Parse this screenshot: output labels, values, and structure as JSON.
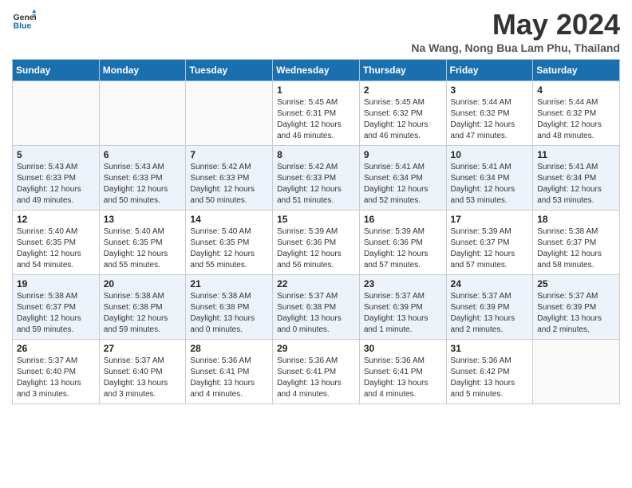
{
  "header": {
    "logo_general": "General",
    "logo_blue": "Blue",
    "month_year": "May 2024",
    "location": "Na Wang, Nong Bua Lam Phu, Thailand"
  },
  "days_of_week": [
    "Sunday",
    "Monday",
    "Tuesday",
    "Wednesday",
    "Thursday",
    "Friday",
    "Saturday"
  ],
  "weeks": [
    [
      {
        "day": "",
        "info": ""
      },
      {
        "day": "",
        "info": ""
      },
      {
        "day": "",
        "info": ""
      },
      {
        "day": "1",
        "info": "Sunrise: 5:45 AM\nSunset: 6:31 PM\nDaylight: 12 hours\nand 46 minutes."
      },
      {
        "day": "2",
        "info": "Sunrise: 5:45 AM\nSunset: 6:32 PM\nDaylight: 12 hours\nand 46 minutes."
      },
      {
        "day": "3",
        "info": "Sunrise: 5:44 AM\nSunset: 6:32 PM\nDaylight: 12 hours\nand 47 minutes."
      },
      {
        "day": "4",
        "info": "Sunrise: 5:44 AM\nSunset: 6:32 PM\nDaylight: 12 hours\nand 48 minutes."
      }
    ],
    [
      {
        "day": "5",
        "info": "Sunrise: 5:43 AM\nSunset: 6:33 PM\nDaylight: 12 hours\nand 49 minutes."
      },
      {
        "day": "6",
        "info": "Sunrise: 5:43 AM\nSunset: 6:33 PM\nDaylight: 12 hours\nand 50 minutes."
      },
      {
        "day": "7",
        "info": "Sunrise: 5:42 AM\nSunset: 6:33 PM\nDaylight: 12 hours\nand 50 minutes."
      },
      {
        "day": "8",
        "info": "Sunrise: 5:42 AM\nSunset: 6:33 PM\nDaylight: 12 hours\nand 51 minutes."
      },
      {
        "day": "9",
        "info": "Sunrise: 5:41 AM\nSunset: 6:34 PM\nDaylight: 12 hours\nand 52 minutes."
      },
      {
        "day": "10",
        "info": "Sunrise: 5:41 AM\nSunset: 6:34 PM\nDaylight: 12 hours\nand 53 minutes."
      },
      {
        "day": "11",
        "info": "Sunrise: 5:41 AM\nSunset: 6:34 PM\nDaylight: 12 hours\nand 53 minutes."
      }
    ],
    [
      {
        "day": "12",
        "info": "Sunrise: 5:40 AM\nSunset: 6:35 PM\nDaylight: 12 hours\nand 54 minutes."
      },
      {
        "day": "13",
        "info": "Sunrise: 5:40 AM\nSunset: 6:35 PM\nDaylight: 12 hours\nand 55 minutes."
      },
      {
        "day": "14",
        "info": "Sunrise: 5:40 AM\nSunset: 6:35 PM\nDaylight: 12 hours\nand 55 minutes."
      },
      {
        "day": "15",
        "info": "Sunrise: 5:39 AM\nSunset: 6:36 PM\nDaylight: 12 hours\nand 56 minutes."
      },
      {
        "day": "16",
        "info": "Sunrise: 5:39 AM\nSunset: 6:36 PM\nDaylight: 12 hours\nand 57 minutes."
      },
      {
        "day": "17",
        "info": "Sunrise: 5:39 AM\nSunset: 6:37 PM\nDaylight: 12 hours\nand 57 minutes."
      },
      {
        "day": "18",
        "info": "Sunrise: 5:38 AM\nSunset: 6:37 PM\nDaylight: 12 hours\nand 58 minutes."
      }
    ],
    [
      {
        "day": "19",
        "info": "Sunrise: 5:38 AM\nSunset: 6:37 PM\nDaylight: 12 hours\nand 59 minutes."
      },
      {
        "day": "20",
        "info": "Sunrise: 5:38 AM\nSunset: 6:38 PM\nDaylight: 12 hours\nand 59 minutes."
      },
      {
        "day": "21",
        "info": "Sunrise: 5:38 AM\nSunset: 6:38 PM\nDaylight: 13 hours\nand 0 minutes."
      },
      {
        "day": "22",
        "info": "Sunrise: 5:37 AM\nSunset: 6:38 PM\nDaylight: 13 hours\nand 0 minutes."
      },
      {
        "day": "23",
        "info": "Sunrise: 5:37 AM\nSunset: 6:39 PM\nDaylight: 13 hours\nand 1 minute."
      },
      {
        "day": "24",
        "info": "Sunrise: 5:37 AM\nSunset: 6:39 PM\nDaylight: 13 hours\nand 2 minutes."
      },
      {
        "day": "25",
        "info": "Sunrise: 5:37 AM\nSunset: 6:39 PM\nDaylight: 13 hours\nand 2 minutes."
      }
    ],
    [
      {
        "day": "26",
        "info": "Sunrise: 5:37 AM\nSunset: 6:40 PM\nDaylight: 13 hours\nand 3 minutes."
      },
      {
        "day": "27",
        "info": "Sunrise: 5:37 AM\nSunset: 6:40 PM\nDaylight: 13 hours\nand 3 minutes."
      },
      {
        "day": "28",
        "info": "Sunrise: 5:36 AM\nSunset: 6:41 PM\nDaylight: 13 hours\nand 4 minutes."
      },
      {
        "day": "29",
        "info": "Sunrise: 5:36 AM\nSunset: 6:41 PM\nDaylight: 13 hours\nand 4 minutes."
      },
      {
        "day": "30",
        "info": "Sunrise: 5:36 AM\nSunset: 6:41 PM\nDaylight: 13 hours\nand 4 minutes."
      },
      {
        "day": "31",
        "info": "Sunrise: 5:36 AM\nSunset: 6:42 PM\nDaylight: 13 hours\nand 5 minutes."
      },
      {
        "day": "",
        "info": ""
      }
    ]
  ]
}
